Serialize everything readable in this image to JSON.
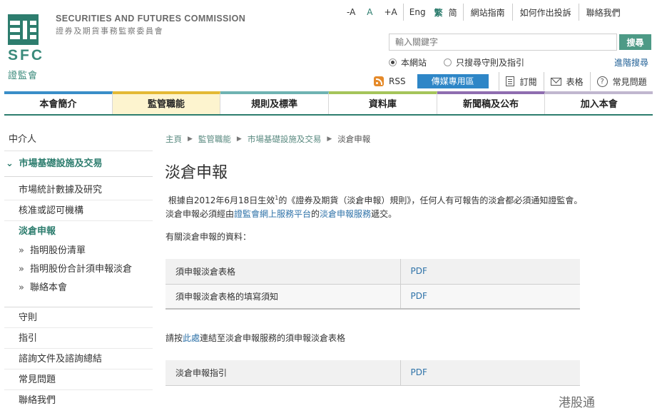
{
  "header": {
    "logo_text": "SFC",
    "logo_cn": "證監會",
    "org_en": "SECURITIES AND FUTURES COMMISSION",
    "org_cn": "證券及期貨事務監察委員會"
  },
  "utility": {
    "font_small": "-A",
    "font_normal": "A",
    "font_large": "+A",
    "lang_en": "Eng",
    "lang_tc": "繁",
    "lang_sc": "简",
    "sitemap": "網站指南",
    "complaint": "如何作出投訴",
    "contact": "聯絡我們"
  },
  "search": {
    "placeholder": "輸入關鍵字",
    "button": "搜尋",
    "scope_site": "本網站",
    "scope_rules": "只搜尋守則及指引",
    "advanced": "進階搜尋"
  },
  "tools": {
    "rss": "RSS",
    "media": "傳媒專用區",
    "subscribe": "訂閱",
    "forms": "表格",
    "faq": "常見問題"
  },
  "nav": {
    "tabs": [
      {
        "label": "本會簡介",
        "color": "#3a8ec8"
      },
      {
        "label": "監管職能",
        "color": "#e4b935"
      },
      {
        "label": "規則及標準",
        "color": "#6fb3b2"
      },
      {
        "label": "資料庫",
        "color": "#a5c45a"
      },
      {
        "label": "新聞稿及公布",
        "color": "#8f6db0"
      },
      {
        "label": "加入本會",
        "color": "#c0b7cf"
      }
    ]
  },
  "sidebar": {
    "top_item": "中介人",
    "section": "市場基礎設施及交易",
    "items": [
      "市場統計數據及研究",
      "核准或認可機構",
      "淡倉申報"
    ],
    "subitems": [
      "指明股份清單",
      "指明股份合計須申報淡倉",
      "聯絡本會"
    ],
    "items2": [
      "守則",
      "指引",
      "諮詢文件及諮詢總結",
      "常見問題",
      "聯絡我們"
    ]
  },
  "breadcrumb": [
    "主頁",
    "監管職能",
    "市場基礎設施及交易",
    "淡倉申報"
  ],
  "content": {
    "title": "淡倉申報",
    "intro_1": "根據自2012年6月18日生效",
    "intro_sup": "1",
    "intro_2": "的《證券及期貨（淡倉申報）規則》，任何人有可報告的淡倉都必須通知證監會。淡倉申報必須經由",
    "intro_link1": "證監會網上服務平台",
    "intro_3": "的",
    "intro_link2": "淡倉申報服務",
    "intro_4": "遞交。",
    "info_heading": "有關淡倉申報的資料：",
    "table1": [
      {
        "name": "須申報淡倉表格",
        "format": "PDF"
      },
      {
        "name": "須申報淡倉表格的填寫須知",
        "format": "PDF"
      }
    ],
    "note_1": "請按",
    "note_link": "此處",
    "note_2": "連結至淡倉申報服務的須申報淡倉表格",
    "table2": [
      {
        "name": "淡倉申報指引",
        "format": "PDF"
      }
    ]
  },
  "watermark": "港股通"
}
